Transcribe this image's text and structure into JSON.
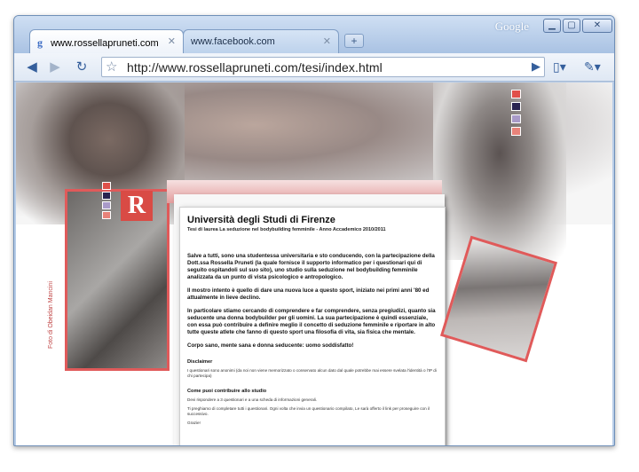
{
  "browser": {
    "brand": "Google",
    "window_buttons": {
      "minimize": "▁",
      "maximize": "▢",
      "close": "✕"
    },
    "tabs": [
      {
        "title": "www.rossellapruneti.com",
        "active": true,
        "icon": "google-favicon",
        "close": "✕"
      },
      {
        "title": "www.facebook.com",
        "active": false,
        "close": "✕"
      }
    ],
    "new_tab": "+",
    "toolbar": {
      "back": "◀",
      "forward": "▶",
      "reload": "↻",
      "star": "☆",
      "go": "▶",
      "page_menu": "▯▾",
      "wrench_menu": "✎▾"
    },
    "url": "http://www.rossellapruneti.com/tesi/index.html"
  },
  "page": {
    "logo_text": "R",
    "photo_credit": "Foto di Obeidan Mancini",
    "swatch_colors": [
      "#e0504a",
      "#2a2450",
      "#a99ac8",
      "#e8837a"
    ],
    "left_swatch_colors": [
      "#e0504a",
      "#2a2450",
      "#a99ac8",
      "#e8837a"
    ],
    "heading": "Università degli Studi di Firenze",
    "subheading": "Tesi di laurea La seduzione nel bodybuilding femminile - Anno Accademico 2010/2011",
    "paragraphs": [
      "Salve a tutti, sono una studentessa universitaria e sto conducendo, con la partecipazione della Dott.ssa Rossella Pruneti (la quale fornisce il supporto informatico per i questionari qui di seguito ospitandoli sul suo sito), uno studio sulla seduzione nel bodybuilding femminile analizzata da un punto di vista psicologico e antropologico.",
      "Il mostro intento è quello di dare una nuova luce a questo sport, iniziato nei primi anni '80 ed attualmente in lieve declino.",
      "In particolare stiamo cercando di comprendere e far comprendere, senza pregiudizi, quanto sia seducente una donna bodybuilder per gli uomini. La sua partecipazione è quindi essenziale, con essa può contribuire a definire meglio il concetto di seduzione femminile e riportare in alto tutte queste atlete che fanno di questo sport una filosofia di vita, sia fisica che mentale.",
      "Corpo sano, mente sana e donna seducente: uomo soddisfatto!"
    ],
    "disclaimer_title": "Disclaimer",
    "disclaimer_text": "I questionari sono anonimi (da noi non viene memorizzato o conservato alcun dato dal quale potrebbe mai essere svelata l'identità o l'IP di chi partecipa)",
    "contribute_title": "Come puoi contribuire allo studio",
    "contribute_text_1": "Devi rispondere a 3 questionari e a una scheda di informazioni generali.",
    "contribute_text_2": "Ti preghiamo di completare tutti i questionari. Ogni volta che invia un questionario compilato, Le sarà offerto il link per proseguire con il successivo.",
    "thanks": "Grazie!"
  }
}
